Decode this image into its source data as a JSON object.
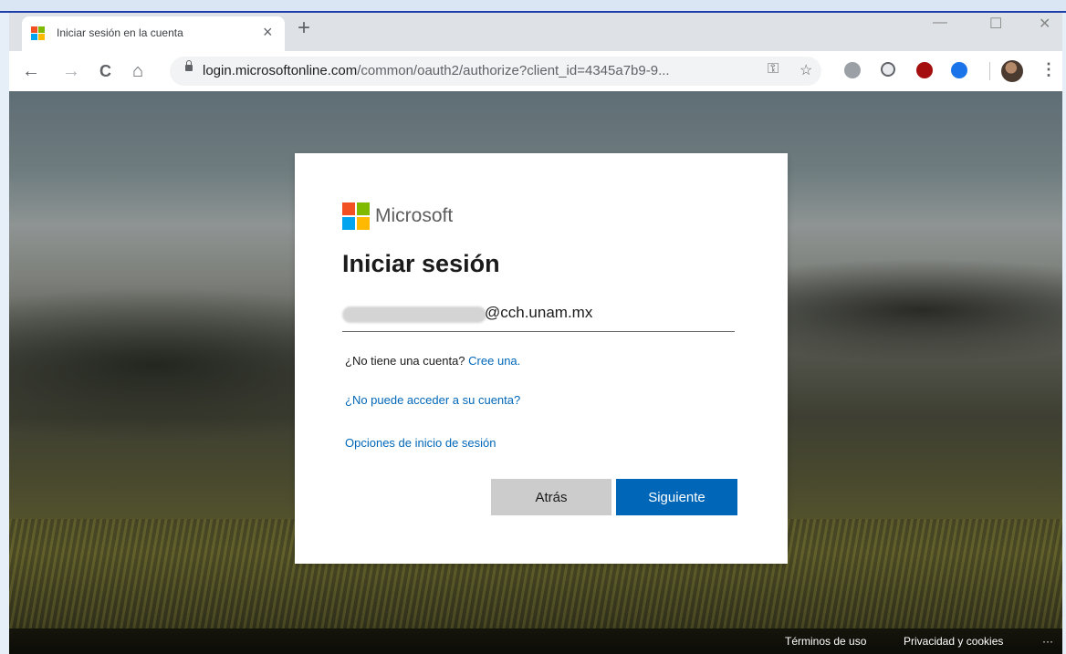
{
  "browser": {
    "tab": {
      "title": "Iniciar sesión en la cuenta",
      "close": "×"
    },
    "new_tab": "+",
    "window_controls": {
      "minimize": "—",
      "maximize": "☐",
      "close": "✕"
    },
    "nav": {
      "back": "←",
      "forward": "→",
      "reload": "C",
      "home": "⌂"
    },
    "url": {
      "host": "login.microsoftonline.com",
      "path": "/common/oauth2/authorize?client_id=4345a7b9-9..."
    },
    "menu": "⋮"
  },
  "signin": {
    "brand": "Microsoft",
    "heading": "Iniciar sesión",
    "email_suffix": "@cch.unam.mx",
    "no_account_prefix": "¿No tiene una cuenta?",
    "create_link": "Cree una.",
    "cant_access_link": "¿No puede acceder a su cuenta?",
    "options_link": "Opciones de inicio de sesión",
    "back_button": "Atrás",
    "next_button": "Siguiente"
  },
  "footer": {
    "terms": "Términos de uso",
    "privacy": "Privacidad y cookies",
    "more": "···"
  },
  "colors": {
    "accent": "#0067b8",
    "ms_red": "#f25022",
    "ms_green": "#7fba00",
    "ms_blue": "#00a4ef",
    "ms_yellow": "#ffb900"
  }
}
